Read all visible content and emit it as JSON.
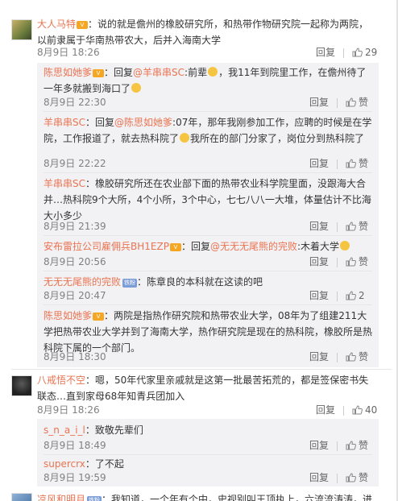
{
  "comments": [
    {
      "user": "大人马特",
      "text": "：说的就是儋州的橡胶研究所，和热带作物研究院一起称为两院，以前隶属于华南热带农大，后并入海南大学",
      "time": "8月9日 18:26",
      "reply_label": "回复",
      "like_count": "29",
      "replies": [
        {
          "user": "陈思如她爹",
          "text_a": "：回复",
          "mention": "@羊串串SC",
          "text_b": ":前辈",
          "text_c": "，我11年到院里工作，在儋州待了一年多就搬到海口了",
          "time": "8月9日 22:30",
          "reply_label": "回复",
          "like_label": "赞"
        },
        {
          "user": "羊串串SC",
          "text_a": "：回复",
          "mention": "@陈思如她爹",
          "text_b": ":07年，那年我刚参加工作，应聘的时候是在学院，工作报道了，就去热科院了",
          "text_c": "我所在的部门分家了，岗位分到热科院了",
          "time": "8月9日 22:22",
          "reply_label": "回复",
          "like_label": "赞"
        },
        {
          "user": "羊串串SC",
          "text_a": "：橡胶研究所还在农业部下面的热带农业科学院里面，没跟海大合并…热科院9个大所，4个小所，3个中心，七七八八一大堆，体量估计不比海大小多少",
          "time": "8月9日 21:39",
          "reply_label": "回复",
          "like_label": "赞"
        },
        {
          "user": "安布雷拉公司雇佣兵BH1EZP",
          "text_a": "：回复",
          "mention": "@无无无尾熊的完败",
          "text_b": ":木着大学",
          "time": "8月9日 20:56",
          "reply_label": "回复",
          "like_label": "赞"
        },
        {
          "user": "无无无尾熊的完败",
          "badge": "铁粉",
          "text_a": "：陈章良的本科就在这读的吧",
          "time": "8月9日 20:47",
          "reply_label": "回复",
          "like_count": "2"
        },
        {
          "user": "陈思如她爹",
          "text_a": "：两院是指热作研究院和热带农业大学，08年为了组建211大学把热带农业大学并到了海南大学，热作研究院是现在的热科院，橡胶所是热科院下属的一个部门。",
          "time": "8月9日 18:30",
          "reply_label": "回复",
          "like_label": "赞"
        }
      ]
    },
    {
      "user": "八戒悟不空",
      "text": "：嗯，50年代家里亲戚就是这第一批最苦拓荒的，都是签保密书失联态…直到家母68年知青兵团加入",
      "time": "8月9日 18:26",
      "reply_label": "回复",
      "like_count": "40",
      "replies": [
        {
          "user": "s_n_a_i_l",
          "text_a": "：致敬先辈们",
          "time": "8月9日 18:49",
          "reply_label": "回复",
          "like_label": "赞"
        },
        {
          "user": "supercrx",
          "text_a": "：了不起",
          "time": "8月9日 19:59",
          "reply_label": "回复",
          "like_label": "赞"
        }
      ]
    },
    {
      "user": "凉风和明月",
      "badge": "铁粉",
      "text": "：我知道，一个年有个中，史视别叫王顶执上，六流流涛涛，进"
    }
  ]
}
